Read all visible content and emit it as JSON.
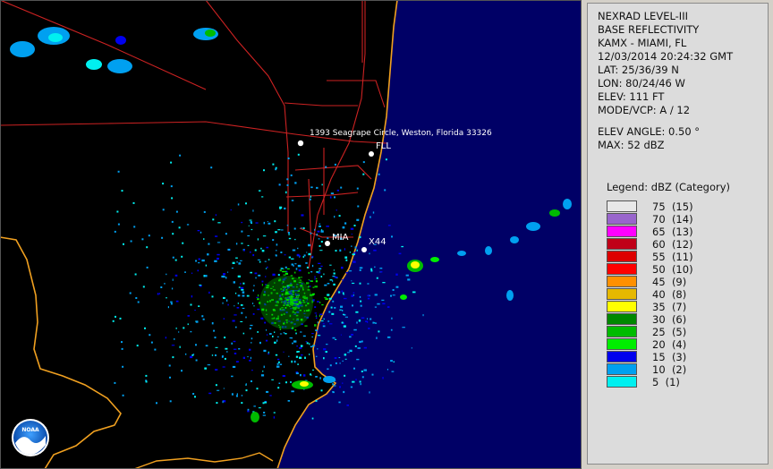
{
  "radar": {
    "product_line1": "NEXRAD LEVEL-III",
    "product_line2": "BASE REFLECTIVITY",
    "station": "KAMX - MIAMI, FL",
    "datetime": "12/03/2014 20:24:32 GMT",
    "lat": "LAT: 25/36/39 N",
    "lon": "LON: 80/24/46 W",
    "elev": "ELEV: 111 FT",
    "mode": "MODE/VCP: A / 12",
    "elev_angle": "ELEV ANGLE: 0.50 °",
    "max": "MAX: 52 dBZ"
  },
  "legend": {
    "title": "Legend: dBZ (Category)",
    "items": [
      {
        "label": "75  (15)",
        "color": "#e8e8e8"
      },
      {
        "label": "70  (14)",
        "color": "#9966cc"
      },
      {
        "label": "65  (13)",
        "color": "#ff00ff"
      },
      {
        "label": "60  (12)",
        "color": "#c00018"
      },
      {
        "label": "55  (11)",
        "color": "#dd0000"
      },
      {
        "label": "50  (10)",
        "color": "#ff0000"
      },
      {
        "label": "45  (9)",
        "color": "#ff9000"
      },
      {
        "label": "40  (8)",
        "color": "#e6b800"
      },
      {
        "label": "35  (7)",
        "color": "#ffff00"
      },
      {
        "label": "30  (6)",
        "color": "#008800"
      },
      {
        "label": "25  (5)",
        "color": "#00bb00"
      },
      {
        "label": "20  (4)",
        "color": "#00ee00"
      },
      {
        "label": "15  (3)",
        "color": "#0000ee"
      },
      {
        "label": "10  (2)",
        "color": "#00a0f0"
      },
      {
        "label": "5  (1)",
        "color": "#00f0f0"
      }
    ]
  },
  "map": {
    "markers": {
      "address": "1393 Seagrape Circle, Weston, Florida 33326",
      "fll": "FLL",
      "mia": "MIA",
      "x44": "X44"
    },
    "logo_text": "NOAA",
    "colors": {
      "ocean": "#000066",
      "land": "#000000",
      "coast": "#f0a020",
      "roads": "#cc2222"
    }
  }
}
